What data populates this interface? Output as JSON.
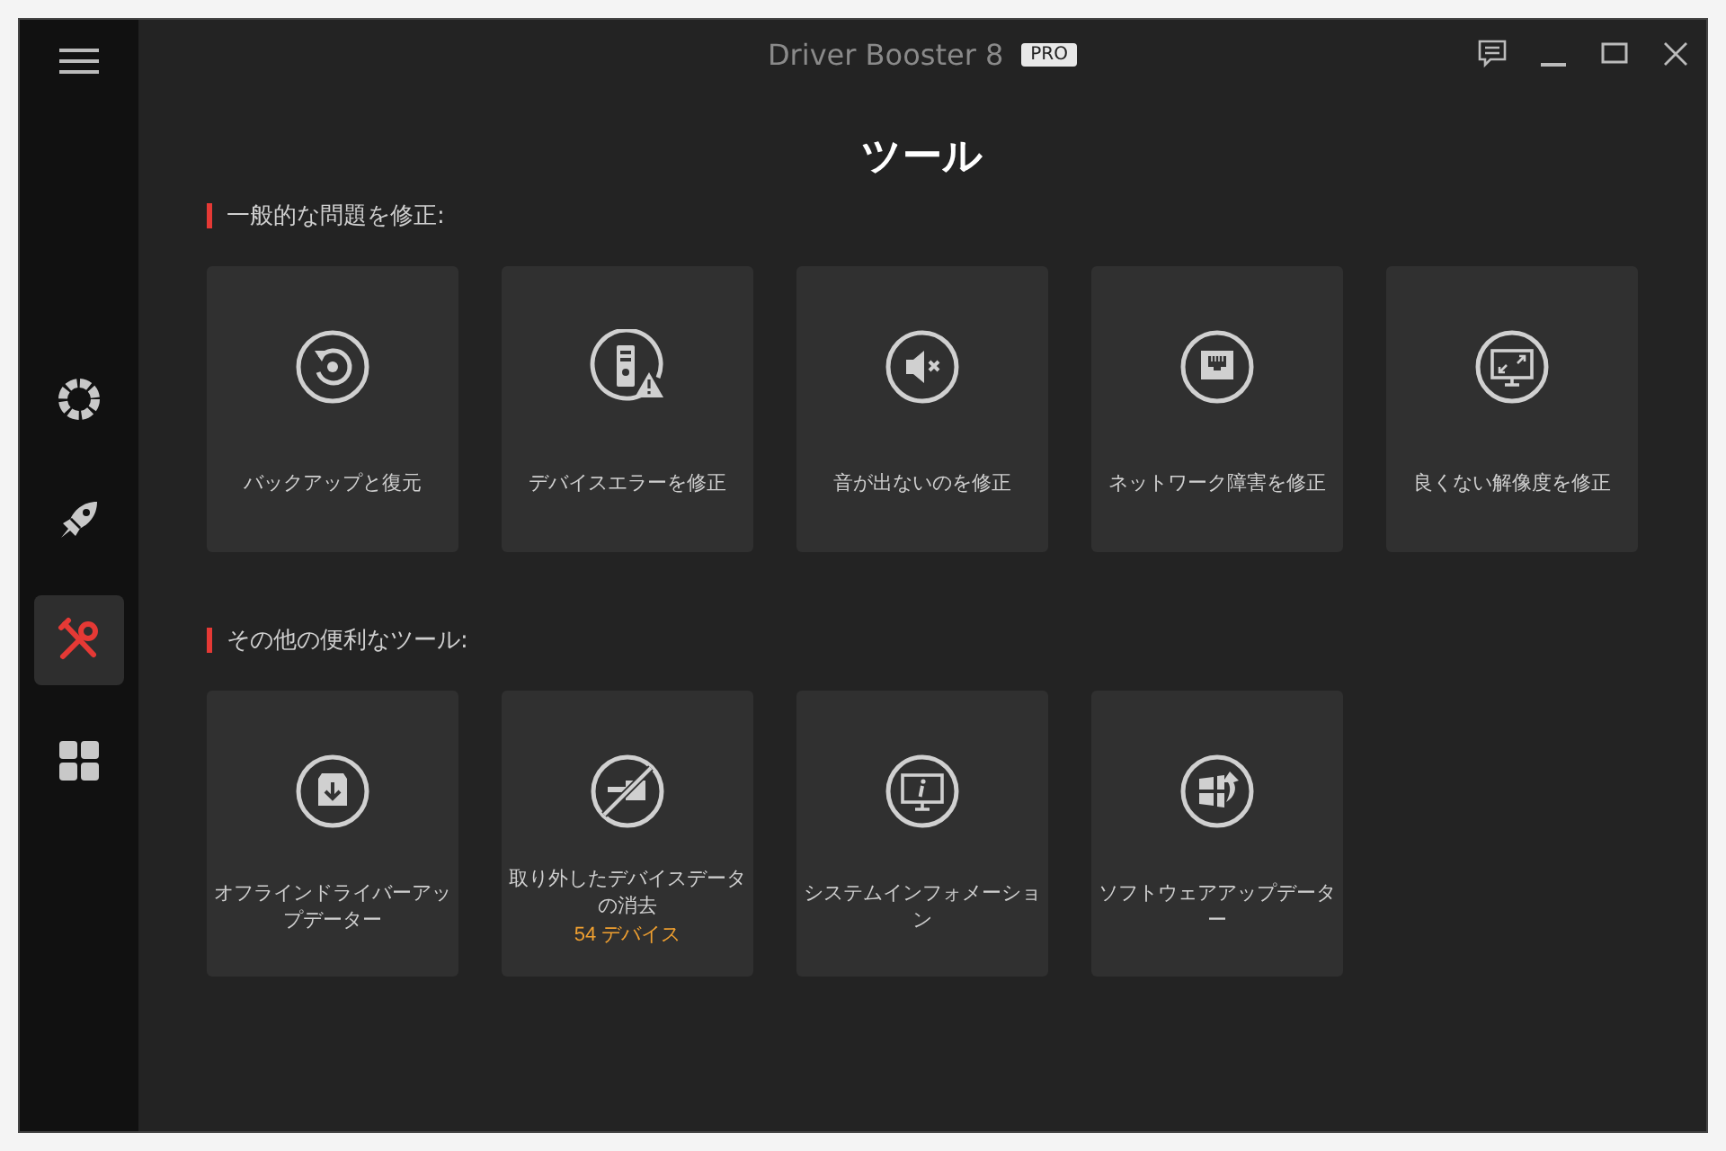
{
  "window": {
    "title": "Driver Booster 8",
    "badge": "PRO"
  },
  "sidebar": {
    "items": [
      {
        "kind": "lifebuoy",
        "selected": false
      },
      {
        "kind": "rocket",
        "selected": false
      },
      {
        "kind": "tools",
        "selected": true
      },
      {
        "kind": "apps",
        "selected": false
      }
    ]
  },
  "page_title": "ツール",
  "sections": [
    {
      "title": "一般的な問題を修正:",
      "tools": [
        {
          "kind": "backup",
          "label": "バックアップと復元"
        },
        {
          "kind": "device-error",
          "label": "デバイスエラーを修正"
        },
        {
          "kind": "sound",
          "label": "音が出ないのを修正"
        },
        {
          "kind": "network",
          "label": "ネットワーク障害を修正"
        },
        {
          "kind": "resolution",
          "label": "良くない解像度を修正"
        }
      ]
    },
    {
      "title": "その他の便利なツール:",
      "tools": [
        {
          "kind": "offline",
          "label": "オフラインドライバーアップデーター"
        },
        {
          "kind": "removed",
          "label": "取り外したデバイスデータの消去",
          "count": "54 デバイス"
        },
        {
          "kind": "sysinfo",
          "label": "システムインフォメーション"
        },
        {
          "kind": "software",
          "label": "ソフトウェアアップデーター"
        }
      ]
    }
  ]
}
